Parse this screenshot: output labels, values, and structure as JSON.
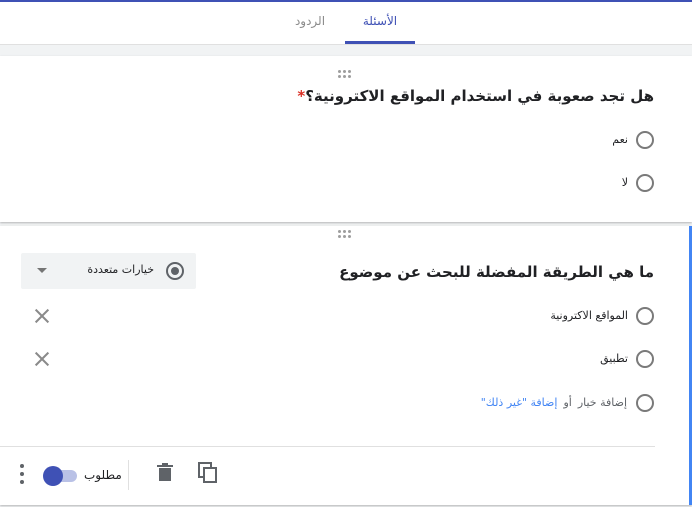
{
  "tabs": {
    "questions": "الأسئلة",
    "responses": "الردود"
  },
  "questions": [
    {
      "title": "هل تجد صعوبة في استخدام المواقع الاكترونية؟",
      "required_marker": "*",
      "options": [
        "نعم",
        "لا"
      ]
    },
    {
      "title": "ما هي الطريقة المفضلة للبحث عن موضوع",
      "options": [
        "المواقع الاكترونية",
        "تطبيق"
      ],
      "type_select": "خيارات متعددة",
      "add_option": "إضافة خيار",
      "or_text": "أو",
      "add_other": "إضافة \"غير ذلك\"",
      "required_label": "مطلوب"
    }
  ],
  "icons": {
    "drag": "drag-handle-icon",
    "close": "close-icon",
    "delete": "trash-icon",
    "duplicate": "copy-icon",
    "more": "more-vert-icon"
  },
  "colors": {
    "accent": "#3f51b5",
    "focus": "#4285f4",
    "required": "#d93025"
  }
}
